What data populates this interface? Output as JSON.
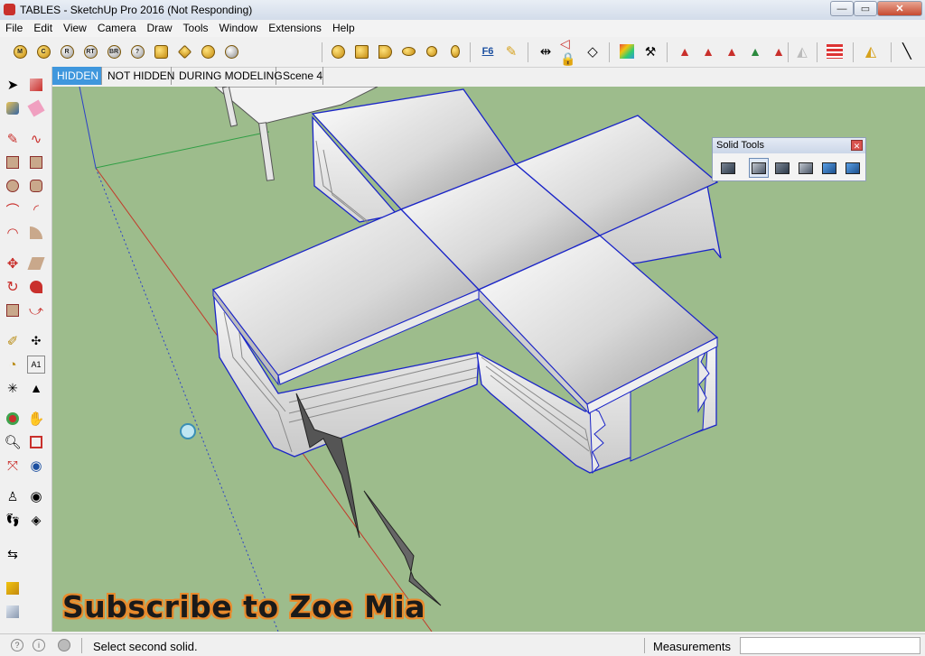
{
  "window": {
    "title": "TABLES - SketchUp Pro 2016 (Not Responding)",
    "min_label": "—",
    "max_label": "▭",
    "close_label": "✕"
  },
  "menu": [
    "File",
    "Edit",
    "View",
    "Camera",
    "Draw",
    "Tools",
    "Window",
    "Extensions",
    "Help"
  ],
  "toolbar": {
    "round_icons": [
      "M",
      "C",
      "R",
      "RT",
      "BR",
      "?"
    ],
    "ruby_label": "F6"
  },
  "scene_tabs": [
    "HIDDEN",
    "NOT HIDDEN",
    "DURING MODELING",
    "Scene 4"
  ],
  "solid_tools": {
    "title": "Solid Tools",
    "close_label": "✕"
  },
  "overlay": {
    "subscribe_text": "Subscribe to Zoe Mia"
  },
  "status": {
    "text": "Select second solid.",
    "measurements_label": "Measurements",
    "measurements_value": ""
  },
  "colors": {
    "viewport_bg": "#9dbc8c",
    "selection_blue": "#1b25c8",
    "active_tab": "#3f97dd",
    "subscribe_outline": "#e88a2c"
  }
}
